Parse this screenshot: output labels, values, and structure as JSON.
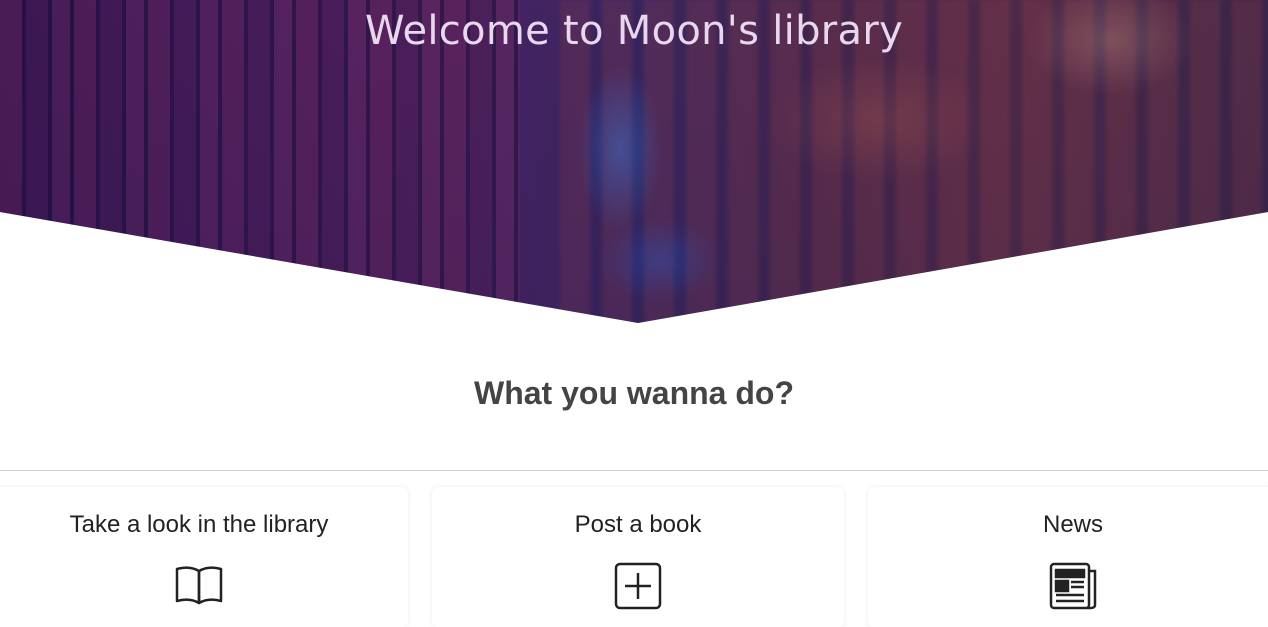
{
  "hero": {
    "title": "Welcome to Moon's library"
  },
  "section": {
    "title": "What you wanna do?"
  },
  "cards": [
    {
      "title": "Take a look in the library",
      "icon": "open-book-icon"
    },
    {
      "title": "Post a book",
      "icon": "plus-square-icon"
    },
    {
      "title": "News",
      "icon": "newspaper-icon"
    }
  ],
  "colors": {
    "hero_title": "#e8d8ee",
    "section_title": "#444444",
    "card_text": "#222222",
    "hero_tint": "#3a1c5c"
  }
}
